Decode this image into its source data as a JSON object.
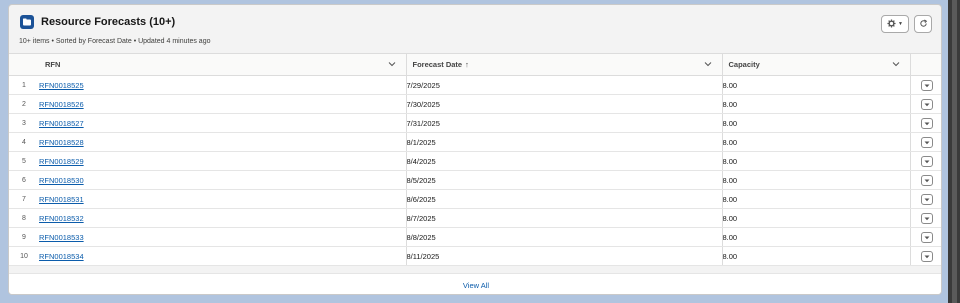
{
  "header": {
    "title": "Resource Forecasts (10+)",
    "subtitle": "10+ items • Sorted by Forecast Date • Updated 4 minutes ago",
    "icon": "list-object-icon",
    "gear_icon": "gear-icon",
    "refresh_icon": "refresh-icon"
  },
  "columns": [
    {
      "label": "RFN"
    },
    {
      "label": "Forecast Date",
      "sort": "↑"
    },
    {
      "label": "Capacity"
    }
  ],
  "rows": [
    {
      "num": "1",
      "rfn": "RFN0018525",
      "date": "7/29/2025",
      "capacity": "8.00"
    },
    {
      "num": "2",
      "rfn": "RFN0018526",
      "date": "7/30/2025",
      "capacity": "8.00"
    },
    {
      "num": "3",
      "rfn": "RFN0018527",
      "date": "7/31/2025",
      "capacity": "8.00"
    },
    {
      "num": "4",
      "rfn": "RFN0018528",
      "date": "8/1/2025",
      "capacity": "8.00"
    },
    {
      "num": "5",
      "rfn": "RFN0018529",
      "date": "8/4/2025",
      "capacity": "8.00"
    },
    {
      "num": "6",
      "rfn": "RFN0018530",
      "date": "8/5/2025",
      "capacity": "8.00"
    },
    {
      "num": "7",
      "rfn": "RFN0018531",
      "date": "8/6/2025",
      "capacity": "8.00"
    },
    {
      "num": "8",
      "rfn": "RFN0018532",
      "date": "8/7/2025",
      "capacity": "8.00"
    },
    {
      "num": "9",
      "rfn": "RFN0018533",
      "date": "8/8/2025",
      "capacity": "8.00"
    },
    {
      "num": "10",
      "rfn": "RFN0018534",
      "date": "8/11/2025",
      "capacity": "8.00"
    }
  ],
  "footer": {
    "view_all": "View All"
  },
  "colors": {
    "brand": "#1b5297",
    "link": "#0b5cab",
    "page_bg": "#b0c4df"
  }
}
